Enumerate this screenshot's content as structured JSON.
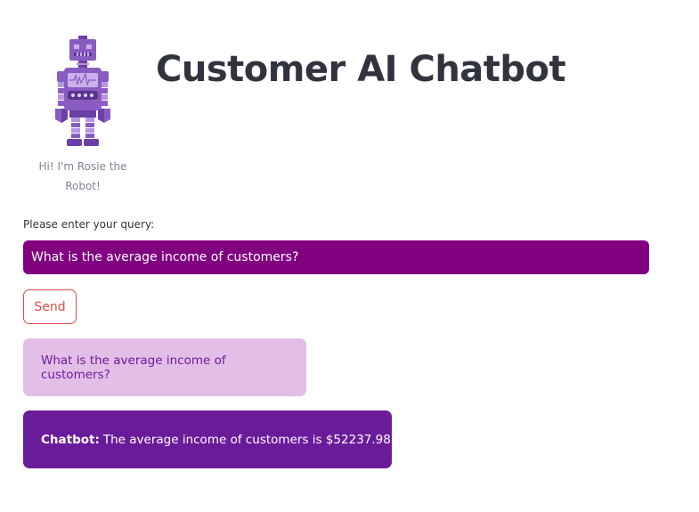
{
  "header": {
    "title": "Customer AI Chatbot"
  },
  "logo": {
    "icon": "robot-icon",
    "caption": "Hi! I'm Rosie the Robot!",
    "colors": {
      "main": "#8a5cc2",
      "light": "#b596e0",
      "dark": "#5a3590"
    }
  },
  "query": {
    "label": "Please enter your query:",
    "value": "What is the average income of customers?"
  },
  "send_button": {
    "label": "Send"
  },
  "conversation": {
    "user_message": "What is the average income of customers?",
    "bot_label": "Chatbot:",
    "bot_message": "The average income of customers is $52237.98."
  },
  "colors": {
    "input_bg": "#800080",
    "user_bubble_bg": "#e3bfe8",
    "bot_bubble_bg": "#6a1b9a",
    "send_button": "#e34a4a",
    "title": "#31333f"
  }
}
